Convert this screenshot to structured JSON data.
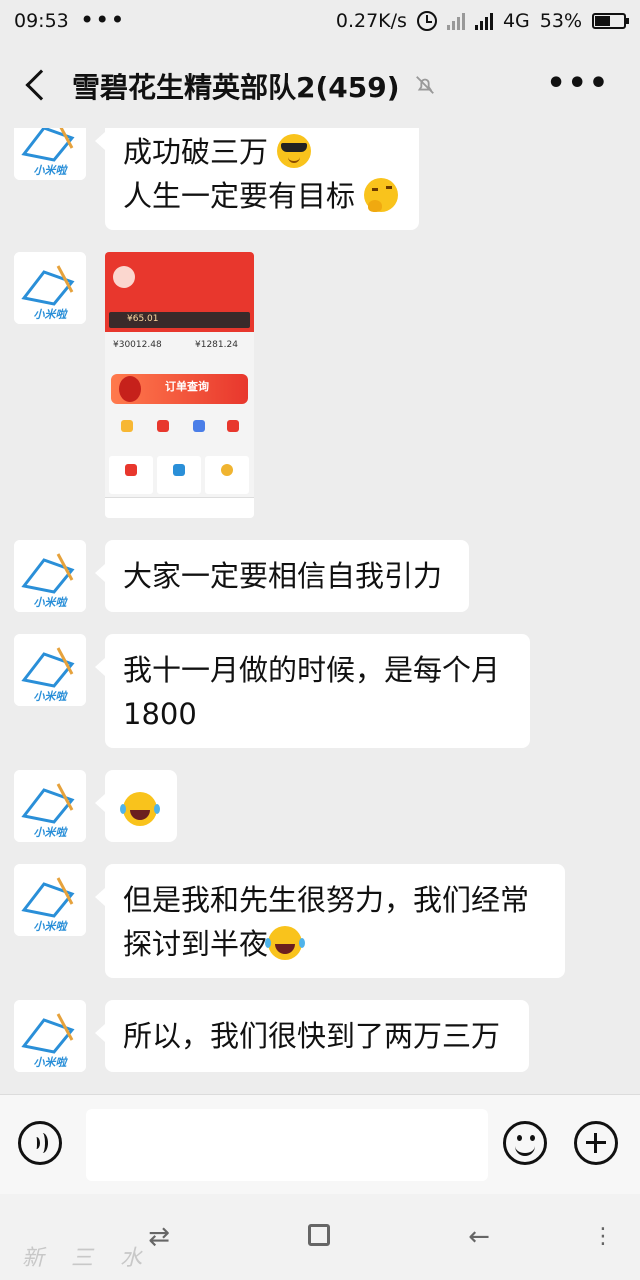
{
  "status_bar": {
    "time": "09:53",
    "network_speed": "0.27K/s",
    "network_type": "4G",
    "battery_percent": "53%",
    "battery_level": 0.53
  },
  "header": {
    "title": "雪碧花生精英部队2(459)",
    "icons": [
      "back-icon",
      "mute-bell-icon",
      "more-icon"
    ]
  },
  "messages": [
    {
      "type": "text",
      "lines": [
        "成功破三万",
        "人生一定要有目标"
      ],
      "emojis": [
        "sunglasses",
        "thinking"
      ]
    },
    {
      "type": "image",
      "screenshot": {
        "amount_1": "¥65.01",
        "amount_2": "¥30012.48",
        "amount_3": "¥1281.24",
        "banner": "订单查询"
      }
    },
    {
      "type": "text",
      "lines": [
        "大家一定要相信自我引力"
      ]
    },
    {
      "type": "text",
      "lines": [
        "我十一月做的时候，是每个月",
        "1800"
      ]
    },
    {
      "type": "emoji",
      "emoji": "laughing-tears"
    },
    {
      "type": "text",
      "lines": [
        "但是我和先生很努力，我们经常",
        "探讨到半夜"
      ],
      "emojis": [
        "laughing-tears"
      ]
    },
    {
      "type": "text",
      "lines": [
        "所以，我们很快到了两万三万"
      ]
    }
  ],
  "input_bar": {
    "placeholder": "",
    "icons": [
      "voice-icon",
      "emoji-icon",
      "plus-icon"
    ]
  },
  "watermark": "新 三 水",
  "colors": {
    "background": "#ededed",
    "bubble": "#ffffff",
    "accent_red": "#e8372d",
    "avatar_blue": "#2a8fd8"
  }
}
